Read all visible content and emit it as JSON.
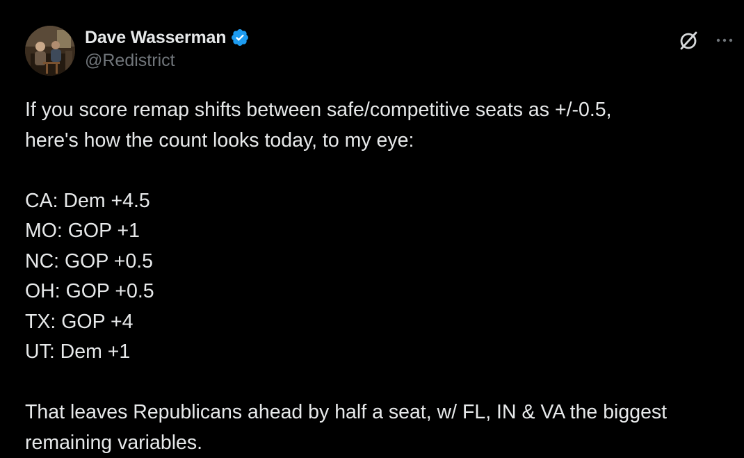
{
  "author": {
    "display_name": "Dave Wasserman",
    "handle": "@Redistrict",
    "verified": true,
    "avatar_icon": "profile-photo"
  },
  "actions": {
    "grok_icon": "grok-icon",
    "more_icon": "more-options-icon"
  },
  "tweet": {
    "intro_line_1": "If you score remap shifts between safe/competitive seats as +/-0.5,",
    "intro_line_2": "here's how the count looks today, to my eye:",
    "states": [
      "CA: Dem +4.5",
      "MO: GOP +1",
      "NC: GOP +0.5",
      "OH: GOP +0.5",
      "TX: GOP +4",
      "UT: Dem +1"
    ],
    "outro_line_1": "That leaves Republicans ahead by half a seat, w/ FL, IN & VA the biggest",
    "outro_line_2": "remaining variables."
  },
  "colors": {
    "background": "#000000",
    "text": "#e7e9ea",
    "secondary_text": "#71767b",
    "verified_badge": "#1d9bf0"
  }
}
